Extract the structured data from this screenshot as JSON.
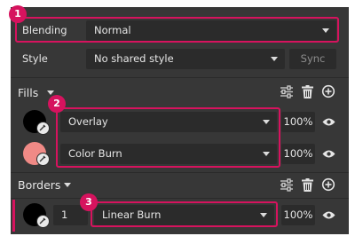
{
  "blending": {
    "label": "Blending",
    "value": "Normal"
  },
  "style": {
    "label": "Style",
    "value": "No shared style",
    "sync_label": "Sync"
  },
  "fills": {
    "title": "Fills",
    "items": [
      {
        "color": "#000000",
        "blend": "Overlay",
        "opacity": "100%"
      },
      {
        "color": "#f08a86",
        "blend": "Color Burn",
        "opacity": "100%"
      }
    ]
  },
  "borders": {
    "title": "Borders",
    "items": [
      {
        "color": "#000000",
        "thickness": "1",
        "blend": "Linear Burn",
        "opacity": "100%"
      }
    ]
  },
  "annotations": [
    "1",
    "2",
    "3"
  ],
  "colors": {
    "accent": "#d6135e",
    "panel": "#373737",
    "field": "#2b2b2b"
  }
}
